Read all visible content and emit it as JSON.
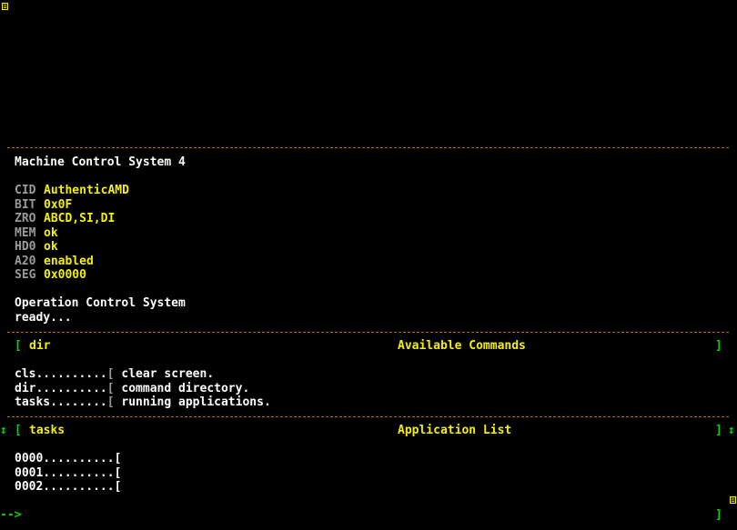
{
  "system": {
    "title": "Machine Control System 4",
    "info": [
      {
        "key": "CID",
        "value": "AuthenticAMD"
      },
      {
        "key": "BIT",
        "value": "0x0F"
      },
      {
        "key": "ZRO",
        "value": "ABCD,SI,DI"
      },
      {
        "key": "MEM",
        "value": "ok"
      },
      {
        "key": "HD0",
        "value": "ok"
      },
      {
        "key": "A20",
        "value": "enabled"
      },
      {
        "key": "SEG",
        "value": "0x0000"
      }
    ],
    "os_name": "Operation Control System",
    "status": "ready..."
  },
  "dir_panel": {
    "bracket_open": "[",
    "command": "dir",
    "title": "Available Commands",
    "bracket_close": "]",
    "rows": [
      {
        "name": "cls..........",
        "sep": "[",
        "desc": " clear screen."
      },
      {
        "name": "dir..........",
        "sep": "[",
        "desc": " command directory."
      },
      {
        "name": "tasks........",
        "sep": "[",
        "desc": " running applications."
      }
    ]
  },
  "tasks_panel": {
    "scroll_icon": "↕",
    "bracket_open": "[",
    "command": "tasks",
    "title": "Application List",
    "bracket_close": "]",
    "right_scroll_icon": "↕",
    "rows": [
      {
        "id": "0000..........",
        "sep": "["
      },
      {
        "id": "0001..........",
        "sep": "["
      },
      {
        "id": "0002..........",
        "sep": "["
      }
    ]
  },
  "prompt": {
    "symbol": "-->",
    "value": "",
    "bracket_close": "]"
  },
  "colors": {
    "background": "#000000",
    "text": "#ffffff",
    "accent": "#f4f000",
    "label": "#9a9a9a",
    "prompt": "#00d800",
    "divider": "#b06a00"
  },
  "icons": {
    "top_left": "window-menu-icon",
    "bottom_right": "window-menu-icon"
  }
}
